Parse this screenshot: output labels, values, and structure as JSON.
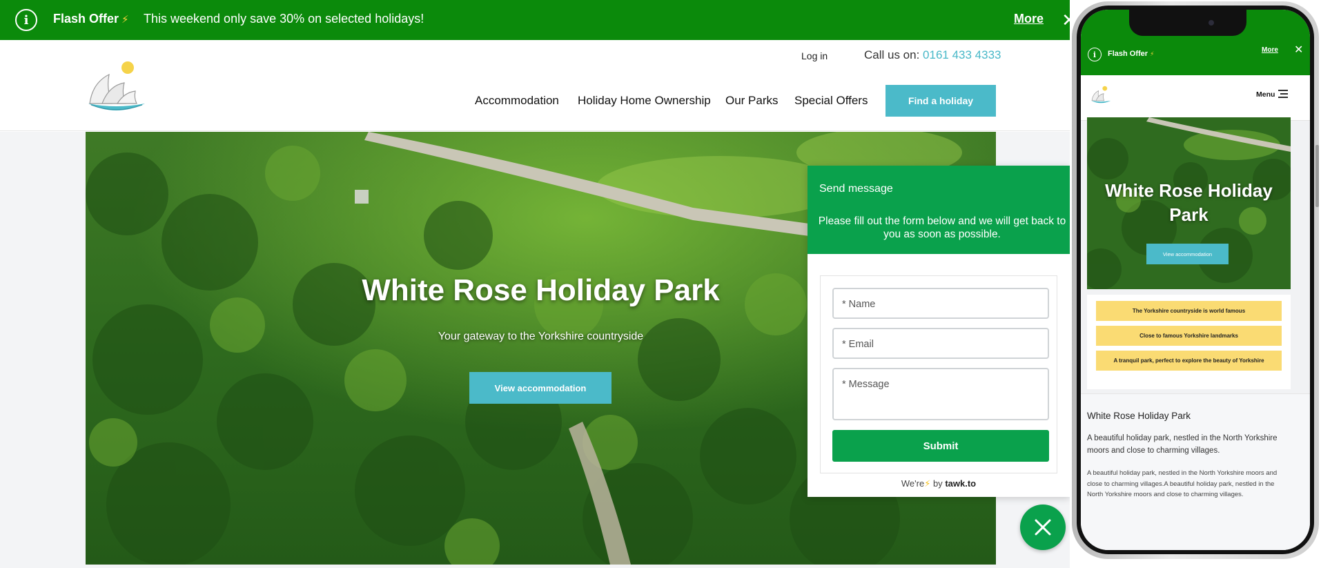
{
  "flash_bar": {
    "title": "Flash Offer",
    "bolt": "⚡",
    "text": "This weekend only save 30% on selected holidays!",
    "more": "More",
    "close": "✕",
    "info": "i",
    "background": "#0b8a0b"
  },
  "header": {
    "login": "Log in",
    "call_label": "Call us on: ",
    "phone": "0161 433 4333",
    "nav": [
      "Accommodation",
      "Holiday Home Ownership",
      "Our Parks",
      "Special Offers"
    ],
    "cta": "Find a holiday",
    "accent": "#4bbac9"
  },
  "hero": {
    "title": "White Rose Holiday Park",
    "subtitle": "Your gateway to the Yorkshire countryside",
    "button": "View accommodation"
  },
  "chat": {
    "title": "Send message",
    "description": "Please fill out the form below and we will get back to you as soon as possible.",
    "name_placeholder": "* Name",
    "email_placeholder": "* Email",
    "message_placeholder": "* Message",
    "submit": "Submit",
    "footer_pre": "We're",
    "footer_bolt": "⚡",
    "footer_by": " by ",
    "footer_brand": "tawk.to",
    "color": "#0aa14c"
  },
  "mobile": {
    "flash_title": "Flash Offer",
    "flash_bolt": "⚡",
    "flash_more": "More",
    "flash_close": "✕",
    "flash_info": "i",
    "menu": "Menu",
    "hero_title": "White Rose Holiday Park",
    "hero_button": "View accommodation",
    "features": [
      "The Yorkshire countryside is world famous",
      "Close to famous Yorkshire landmarks",
      "A tranquil park, perfect to explore the beauty of Yorkshire"
    ],
    "section_title": "White Rose Holiday Park",
    "para1": "A beautiful holiday park, nestled in the North Yorkshire moors and close to charming villages.",
    "para2": "A beautiful holiday park, nestled in the North Yorkshire moors and close to charming villages.A beautiful holiday park, nestled in the North Yorkshire moors and close to charming villages.",
    "feature_color": "#fadb73"
  }
}
